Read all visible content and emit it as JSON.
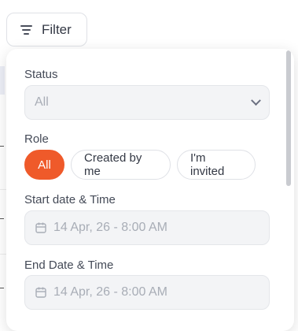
{
  "filter_button": {
    "label": "Filter",
    "icon": "filter-lines-icon"
  },
  "panel": {
    "status": {
      "label": "Status",
      "value": "All"
    },
    "role": {
      "label": "Role",
      "options": [
        "All",
        "Created by me",
        "I'm invited"
      ],
      "selected": "All"
    },
    "start": {
      "label": "Start date & Time",
      "placeholder": "14 Apr, 26 - 8:00 AM"
    },
    "end": {
      "label": "End Date & Time",
      "placeholder": "14 Apr, 26 - 8:00 AM"
    }
  },
  "colors": {
    "accent": "#ef5a2a",
    "field_bg": "#f3f4f6",
    "border": "#dfe1e6"
  }
}
